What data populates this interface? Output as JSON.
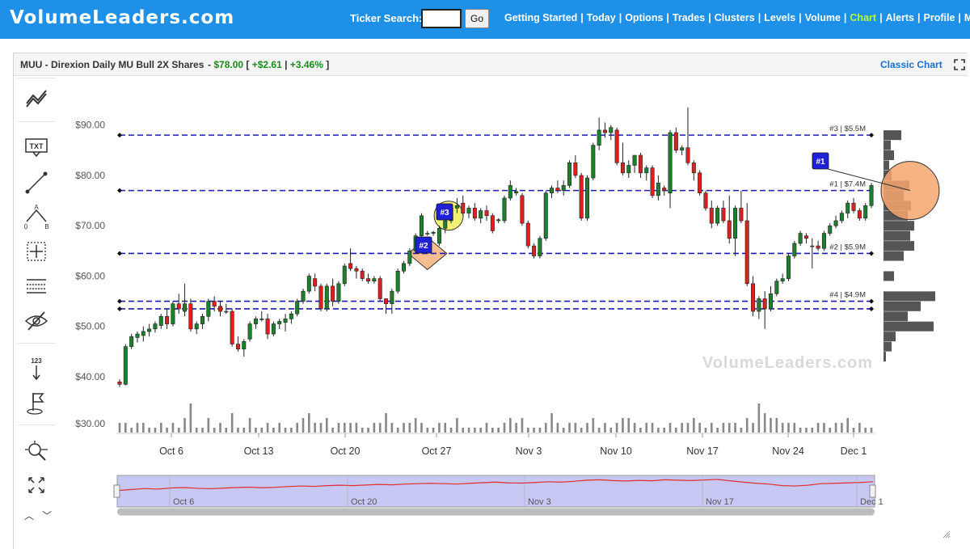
{
  "header": {
    "logo": "VolumeLeaders.com",
    "ticker_label": "Ticker Search:",
    "ticker_value": "",
    "go_label": "Go",
    "nav": [
      "Getting Started",
      "Today",
      "Options",
      "Trades",
      "Clusters",
      "Levels",
      "Volume",
      "Chart",
      "Alerts",
      "Profile",
      "My Subs"
    ],
    "nav_active": "Chart",
    "nav_sep": "|"
  },
  "panel": {
    "title": "MUU - Direxion Daily MU Bull 2X Shares",
    "quote_prefix": "-",
    "price": "$78.00",
    "quote_open": "[",
    "change": "+$2.61",
    "quote_sep": "|",
    "change_pct": "+3.46%",
    "quote_close": "]",
    "classic_label": "Classic Chart"
  },
  "toolbar": {
    "icons": [
      "trend-line-tool-icon",
      "text-tool-icon",
      "line-tool-icon",
      "abcd-pattern-icon",
      "crosshair-icon",
      "horizontal-lines-icon",
      "hide-drawings-icon",
      "ranking-icon",
      "flag-icon",
      "zoom-icon",
      "fullscreen-icon"
    ],
    "text_icon_label": "TXT",
    "ranking_label": "123",
    "abcd_labels": [
      "A",
      "0",
      "B"
    ]
  },
  "chart_data": {
    "type": "candlestick",
    "ylim": [
      36,
      96
    ],
    "y_ticks": [
      "$90.00",
      "$80.00",
      "$70.00",
      "$60.00",
      "$50.00",
      "$40.00",
      "$30.00"
    ],
    "y_tick_values": [
      90,
      80,
      70,
      60,
      50,
      40,
      30
    ],
    "x_ticks": [
      "Oct 6",
      "Oct 13",
      "Oct 20",
      "Oct 27",
      "Nov 3",
      "Nov 10",
      "Nov 17",
      "Nov 24",
      "Dec 1"
    ],
    "navigator_ticks": [
      "Oct 6",
      "Oct 20",
      "Nov 3",
      "Nov 17",
      "Dec 1"
    ],
    "watermark": "VolumeLeaders.com",
    "colors": {
      "up": "#1c7f2c",
      "down": "#e01e1e",
      "level": "#1a1ab8",
      "volume": "#888888",
      "navigator_line": "#e03030",
      "navigator_fill": "#c8c8f5"
    },
    "candles": [
      {
        "o": 39.0,
        "h": 39.5,
        "l": 38.0,
        "c": 38.5
      },
      {
        "o": 38.5,
        "h": 46.5,
        "l": 38.3,
        "c": 46.0
      },
      {
        "o": 46.0,
        "h": 48.5,
        "l": 45.5,
        "c": 48.0
      },
      {
        "o": 47.8,
        "h": 49.0,
        "l": 46.8,
        "c": 48.5
      },
      {
        "o": 48.2,
        "h": 50.0,
        "l": 47.0,
        "c": 49.0
      },
      {
        "o": 49.0,
        "h": 50.5,
        "l": 48.0,
        "c": 49.5
      },
      {
        "o": 49.5,
        "h": 51.0,
        "l": 48.8,
        "c": 50.5
      },
      {
        "o": 50.2,
        "h": 52.5,
        "l": 49.5,
        "c": 52.0
      },
      {
        "o": 52.0,
        "h": 53.5,
        "l": 49.5,
        "c": 50.5
      },
      {
        "o": 50.5,
        "h": 55.0,
        "l": 50.0,
        "c": 54.5
      },
      {
        "o": 54.5,
        "h": 56.5,
        "l": 52.5,
        "c": 53.5
      },
      {
        "o": 53.0,
        "h": 58.5,
        "l": 52.0,
        "c": 54.5
      },
      {
        "o": 54.5,
        "h": 55.5,
        "l": 49.0,
        "c": 49.5
      },
      {
        "o": 49.5,
        "h": 51.0,
        "l": 48.5,
        "c": 50.5
      },
      {
        "o": 50.5,
        "h": 52.5,
        "l": 49.5,
        "c": 52.0
      },
      {
        "o": 52.0,
        "h": 55.5,
        "l": 51.0,
        "c": 55.0
      },
      {
        "o": 55.0,
        "h": 56.0,
        "l": 53.0,
        "c": 54.0
      },
      {
        "o": 54.0,
        "h": 55.0,
        "l": 52.0,
        "c": 53.0
      },
      {
        "o": 53.0,
        "h": 54.5,
        "l": 52.5,
        "c": 53.0
      },
      {
        "o": 53.0,
        "h": 53.5,
        "l": 46.0,
        "c": 46.5
      },
      {
        "o": 46.5,
        "h": 48.0,
        "l": 45.0,
        "c": 45.5
      },
      {
        "o": 45.5,
        "h": 47.5,
        "l": 44.0,
        "c": 47.0
      },
      {
        "o": 47.5,
        "h": 51.0,
        "l": 47.0,
        "c": 50.5
      },
      {
        "o": 50.5,
        "h": 52.0,
        "l": 49.5,
        "c": 51.5
      },
      {
        "o": 51.5,
        "h": 53.0,
        "l": 51.0,
        "c": 51.5
      },
      {
        "o": 51.5,
        "h": 52.5,
        "l": 47.5,
        "c": 48.5
      },
      {
        "o": 48.5,
        "h": 51.0,
        "l": 48.0,
        "c": 50.5
      },
      {
        "o": 50.5,
        "h": 51.5,
        "l": 49.5,
        "c": 51.0
      },
      {
        "o": 50.8,
        "h": 52.5,
        "l": 49.0,
        "c": 51.5
      },
      {
        "o": 51.5,
        "h": 53.0,
        "l": 50.5,
        "c": 52.5
      },
      {
        "o": 52.5,
        "h": 55.5,
        "l": 52.0,
        "c": 55.0
      },
      {
        "o": 55.0,
        "h": 57.5,
        "l": 54.5,
        "c": 57.0
      },
      {
        "o": 57.0,
        "h": 60.5,
        "l": 56.5,
        "c": 60.0
      },
      {
        "o": 59.5,
        "h": 60.5,
        "l": 57.0,
        "c": 58.0
      },
      {
        "o": 58.0,
        "h": 58.5,
        "l": 53.0,
        "c": 53.5
      },
      {
        "o": 53.5,
        "h": 58.5,
        "l": 53.0,
        "c": 58.0
      },
      {
        "o": 58.0,
        "h": 59.5,
        "l": 54.0,
        "c": 55.0
      },
      {
        "o": 55.0,
        "h": 59.0,
        "l": 54.5,
        "c": 58.5
      },
      {
        "o": 58.5,
        "h": 62.5,
        "l": 58.0,
        "c": 62.0
      },
      {
        "o": 62.5,
        "h": 65.5,
        "l": 61.0,
        "c": 61.5
      },
      {
        "o": 61.5,
        "h": 62.0,
        "l": 59.5,
        "c": 61.0
      },
      {
        "o": 61.0,
        "h": 61.5,
        "l": 59.0,
        "c": 59.5
      },
      {
        "o": 59.5,
        "h": 60.5,
        "l": 58.5,
        "c": 59.0
      },
      {
        "o": 59.0,
        "h": 60.0,
        "l": 58.5,
        "c": 59.5
      },
      {
        "o": 59.5,
        "h": 60.0,
        "l": 55.0,
        "c": 55.5
      },
      {
        "o": 55.5,
        "h": 55.5,
        "l": 52.5,
        "c": 54.5
      },
      {
        "o": 54.5,
        "h": 57.5,
        "l": 52.5,
        "c": 57.0
      },
      {
        "o": 57.0,
        "h": 61.5,
        "l": 56.5,
        "c": 61.0
      },
      {
        "o": 61.0,
        "h": 63.0,
        "l": 60.5,
        "c": 62.5
      },
      {
        "o": 62.5,
        "h": 65.5,
        "l": 62.0,
        "c": 65.0
      },
      {
        "o": 65.0,
        "h": 68.5,
        "l": 64.5,
        "c": 68.0
      },
      {
        "o": 68.0,
        "h": 72.5,
        "l": 67.5,
        "c": 72.0
      },
      {
        "o": 68.5,
        "h": 69.0,
        "l": 68.0,
        "c": 68.5
      },
      {
        "o": 68.5,
        "h": 69.0,
        "l": 68.0,
        "c": 68.7
      },
      {
        "o": 66.5,
        "h": 70.0,
        "l": 66.0,
        "c": 69.5
      },
      {
        "o": 69.5,
        "h": 71.5,
        "l": 68.5,
        "c": 71.0
      },
      {
        "o": 71.0,
        "h": 74.0,
        "l": 70.5,
        "c": 73.5
      },
      {
        "o": 73.5,
        "h": 75.5,
        "l": 72.5,
        "c": 74.0
      },
      {
        "o": 74.5,
        "h": 76.0,
        "l": 72.0,
        "c": 72.5
      },
      {
        "o": 72.5,
        "h": 74.0,
        "l": 71.5,
        "c": 73.5
      },
      {
        "o": 73.5,
        "h": 74.5,
        "l": 71.0,
        "c": 71.5
      },
      {
        "o": 71.5,
        "h": 73.5,
        "l": 70.5,
        "c": 73.0
      },
      {
        "o": 73.0,
        "h": 74.0,
        "l": 71.0,
        "c": 72.0
      },
      {
        "o": 72.0,
        "h": 72.5,
        "l": 68.5,
        "c": 69.0
      },
      {
        "o": 71.0,
        "h": 71.5,
        "l": 70.5,
        "c": 71.2
      },
      {
        "o": 71.0,
        "h": 76.0,
        "l": 70.5,
        "c": 75.5
      },
      {
        "o": 75.5,
        "h": 79.0,
        "l": 75.0,
        "c": 78.0
      },
      {
        "o": 76.5,
        "h": 77.5,
        "l": 76.0,
        "c": 76.8
      },
      {
        "o": 76.0,
        "h": 76.5,
        "l": 70.0,
        "c": 70.5
      },
      {
        "o": 70.5,
        "h": 71.0,
        "l": 65.5,
        "c": 66.0
      },
      {
        "o": 66.0,
        "h": 66.5,
        "l": 63.5,
        "c": 64.0
      },
      {
        "o": 64.0,
        "h": 68.0,
        "l": 63.5,
        "c": 67.5
      },
      {
        "o": 67.5,
        "h": 77.0,
        "l": 67.0,
        "c": 76.5
      },
      {
        "o": 76.5,
        "h": 78.0,
        "l": 75.5,
        "c": 77.5
      },
      {
        "o": 77.5,
        "h": 79.0,
        "l": 76.5,
        "c": 77.0
      },
      {
        "o": 77.0,
        "h": 79.0,
        "l": 76.0,
        "c": 78.0
      },
      {
        "o": 78.0,
        "h": 83.0,
        "l": 77.5,
        "c": 82.5
      },
      {
        "o": 82.5,
        "h": 84.0,
        "l": 79.5,
        "c": 80.0
      },
      {
        "o": 80.0,
        "h": 80.5,
        "l": 71.0,
        "c": 71.5
      },
      {
        "o": 71.5,
        "h": 80.0,
        "l": 71.0,
        "c": 79.5
      },
      {
        "o": 79.5,
        "h": 86.5,
        "l": 79.0,
        "c": 86.0
      },
      {
        "o": 86.0,
        "h": 91.5,
        "l": 85.0,
        "c": 89.0
      },
      {
        "o": 89.0,
        "h": 90.5,
        "l": 87.5,
        "c": 88.5
      },
      {
        "o": 88.5,
        "h": 90.0,
        "l": 87.0,
        "c": 89.5
      },
      {
        "o": 89.0,
        "h": 89.5,
        "l": 82.0,
        "c": 82.5
      },
      {
        "o": 82.5,
        "h": 86.5,
        "l": 80.0,
        "c": 80.5
      },
      {
        "o": 80.5,
        "h": 83.0,
        "l": 79.5,
        "c": 82.0
      },
      {
        "o": 82.0,
        "h": 84.0,
        "l": 80.5,
        "c": 84.0
      },
      {
        "o": 84.0,
        "h": 84.5,
        "l": 79.5,
        "c": 80.5
      },
      {
        "o": 80.5,
        "h": 82.0,
        "l": 79.0,
        "c": 81.5
      },
      {
        "o": 81.5,
        "h": 82.0,
        "l": 75.5,
        "c": 76.0
      },
      {
        "o": 76.0,
        "h": 80.0,
        "l": 75.0,
        "c": 78.5
      },
      {
        "o": 77.5,
        "h": 78.0,
        "l": 76.0,
        "c": 77.0
      },
      {
        "o": 76.5,
        "h": 89.0,
        "l": 73.5,
        "c": 88.5
      },
      {
        "o": 88.5,
        "h": 89.5,
        "l": 84.5,
        "c": 85.0
      },
      {
        "o": 85.0,
        "h": 86.0,
        "l": 84.0,
        "c": 85.5
      },
      {
        "o": 85.5,
        "h": 93.5,
        "l": 82.0,
        "c": 82.5
      },
      {
        "o": 82.5,
        "h": 83.0,
        "l": 79.0,
        "c": 80.5
      },
      {
        "o": 80.5,
        "h": 81.0,
        "l": 76.0,
        "c": 76.5
      },
      {
        "o": 76.5,
        "h": 77.0,
        "l": 73.0,
        "c": 73.5
      },
      {
        "o": 73.5,
        "h": 75.0,
        "l": 69.5,
        "c": 70.5
      },
      {
        "o": 70.5,
        "h": 74.0,
        "l": 70.0,
        "c": 73.5
      },
      {
        "o": 73.5,
        "h": 75.0,
        "l": 70.5,
        "c": 71.0
      },
      {
        "o": 71.0,
        "h": 76.0,
        "l": 66.5,
        "c": 67.5
      },
      {
        "o": 67.5,
        "h": 74.0,
        "l": 64.0,
        "c": 73.5
      },
      {
        "o": 73.5,
        "h": 77.0,
        "l": 70.5,
        "c": 71.0
      },
      {
        "o": 71.0,
        "h": 74.5,
        "l": 58.0,
        "c": 58.5
      },
      {
        "o": 58.5,
        "h": 60.0,
        "l": 52.0,
        "c": 53.0
      },
      {
        "o": 53.0,
        "h": 56.0,
        "l": 51.5,
        "c": 55.5
      },
      {
        "o": 55.5,
        "h": 57.0,
        "l": 49.5,
        "c": 53.5
      },
      {
        "o": 53.5,
        "h": 58.0,
        "l": 53.0,
        "c": 56.5
      },
      {
        "o": 56.5,
        "h": 59.5,
        "l": 56.0,
        "c": 59.0
      },
      {
        "o": 59.0,
        "h": 60.5,
        "l": 58.5,
        "c": 59.5
      },
      {
        "o": 59.5,
        "h": 64.5,
        "l": 59.0,
        "c": 64.0
      },
      {
        "o": 64.0,
        "h": 67.0,
        "l": 63.5,
        "c": 66.5
      },
      {
        "o": 66.5,
        "h": 69.0,
        "l": 66.0,
        "c": 68.5
      },
      {
        "o": 68.0,
        "h": 68.5,
        "l": 66.5,
        "c": 67.5
      },
      {
        "o": 66.0,
        "h": 67.5,
        "l": 61.5,
        "c": 66.0
      },
      {
        "o": 66.0,
        "h": 67.0,
        "l": 65.0,
        "c": 65.5
      },
      {
        "o": 65.5,
        "h": 69.0,
        "l": 65.0,
        "c": 68.5
      },
      {
        "o": 68.5,
        "h": 70.5,
        "l": 68.0,
        "c": 70.0
      },
      {
        "o": 70.0,
        "h": 72.0,
        "l": 69.5,
        "c": 71.0
      },
      {
        "o": 71.0,
        "h": 73.0,
        "l": 70.5,
        "c": 72.5
      },
      {
        "o": 72.5,
        "h": 75.0,
        "l": 71.5,
        "c": 74.5
      },
      {
        "o": 74.5,
        "h": 75.5,
        "l": 72.5,
        "c": 73.0
      },
      {
        "o": 73.0,
        "h": 73.5,
        "l": 71.0,
        "c": 71.5
      },
      {
        "o": 71.5,
        "h": 74.5,
        "l": 71.0,
        "c": 74.0
      },
      {
        "o": 74.0,
        "h": 78.5,
        "l": 73.5,
        "c": 78.0
      }
    ],
    "volume": [
      2,
      2,
      1,
      2,
      2,
      1,
      1,
      2,
      1,
      2,
      1,
      3,
      6,
      1,
      1,
      3,
      1,
      2,
      1,
      4,
      1,
      1,
      3,
      1,
      1,
      2,
      1,
      2,
      1,
      1,
      2,
      3,
      4,
      2,
      2,
      3,
      1,
      2,
      2,
      2,
      2,
      1,
      1,
      2,
      2,
      4,
      2,
      1,
      2,
      2,
      3,
      2,
      1,
      1,
      2,
      2,
      1,
      3,
      1,
      1,
      1,
      1,
      2,
      1,
      1,
      2,
      3,
      2,
      3,
      1,
      1,
      1,
      2,
      4,
      2,
      1,
      2,
      2,
      1,
      2,
      3,
      1,
      2,
      1,
      2,
      3,
      3,
      2,
      1,
      2,
      2,
      1,
      1,
      2,
      1,
      2,
      2,
      3,
      2,
      1,
      2,
      1,
      2,
      2,
      2,
      1,
      3,
      2,
      6,
      4,
      3,
      3,
      2,
      2,
      2,
      1,
      1,
      1,
      2,
      2,
      1,
      2,
      2,
      3,
      1,
      2,
      1,
      1,
      1,
      1,
      1
    ],
    "levels": [
      {
        "price": 88.0,
        "label": "#3 | $5.5M"
      },
      {
        "price": 77.0,
        "label": "#1 | $7.4M"
      },
      {
        "price": 64.5,
        "label": "#2 | $5.9M"
      },
      {
        "price": 55.0,
        "label": "#4 | $4.9M"
      },
      {
        "price": 53.5,
        "label": ""
      }
    ],
    "markers": [
      {
        "label": "#1",
        "index": 133,
        "price": 77.0,
        "shape": "circle",
        "color": "#f7a66e"
      },
      {
        "label": "#2",
        "index": 52,
        "price": 64.5,
        "shape": "diamond",
        "color": "#f5b17e"
      },
      {
        "label": "#3",
        "index": 56,
        "price": 72.0,
        "shape": "circle",
        "color": "#eeee66"
      }
    ],
    "volume_profile": [
      {
        "price": 88.0,
        "width": 22
      },
      {
        "price": 86.0,
        "width": 9
      },
      {
        "price": 84.0,
        "width": 13
      },
      {
        "price": 82.0,
        "width": 7
      },
      {
        "price": 80.0,
        "width": 10
      },
      {
        "price": 78.0,
        "width": 32
      },
      {
        "price": 76.0,
        "width": 25
      },
      {
        "price": 74.0,
        "width": 34
      },
      {
        "price": 72.0,
        "width": 30
      },
      {
        "price": 70.0,
        "width": 38
      },
      {
        "price": 68.0,
        "width": 33
      },
      {
        "price": 66.0,
        "width": 38
      },
      {
        "price": 64.0,
        "width": 25
      },
      {
        "price": 60.0,
        "width": 13
      },
      {
        "price": 56.0,
        "width": 64
      },
      {
        "price": 54.0,
        "width": 46
      },
      {
        "price": 52.0,
        "width": 30
      },
      {
        "price": 50.0,
        "width": 62
      },
      {
        "price": 48.0,
        "width": 15
      },
      {
        "price": 46.0,
        "width": 10
      },
      {
        "price": 44.0,
        "width": 3
      }
    ],
    "navigator": [
      0.35,
      0.4,
      0.45,
      0.42,
      0.48,
      0.5,
      0.46,
      0.44,
      0.47,
      0.5,
      0.52,
      0.49,
      0.51,
      0.55,
      0.58,
      0.56,
      0.6,
      0.62,
      0.6,
      0.63,
      0.66,
      0.64,
      0.68,
      0.7,
      0.72,
      0.7,
      0.68,
      0.72,
      0.75,
      0.78,
      0.74,
      0.73,
      0.76,
      0.8,
      0.78,
      0.82,
      0.88,
      0.9,
      0.86,
      0.84,
      0.87,
      0.85,
      0.9,
      0.88,
      0.86,
      0.89,
      0.92,
      0.85,
      0.78,
      0.72,
      0.68,
      0.6,
      0.58,
      0.62,
      0.7,
      0.72,
      0.74,
      0.76,
      0.8
    ],
    "title": "",
    "xlabel": "",
    "ylabel": ""
  }
}
